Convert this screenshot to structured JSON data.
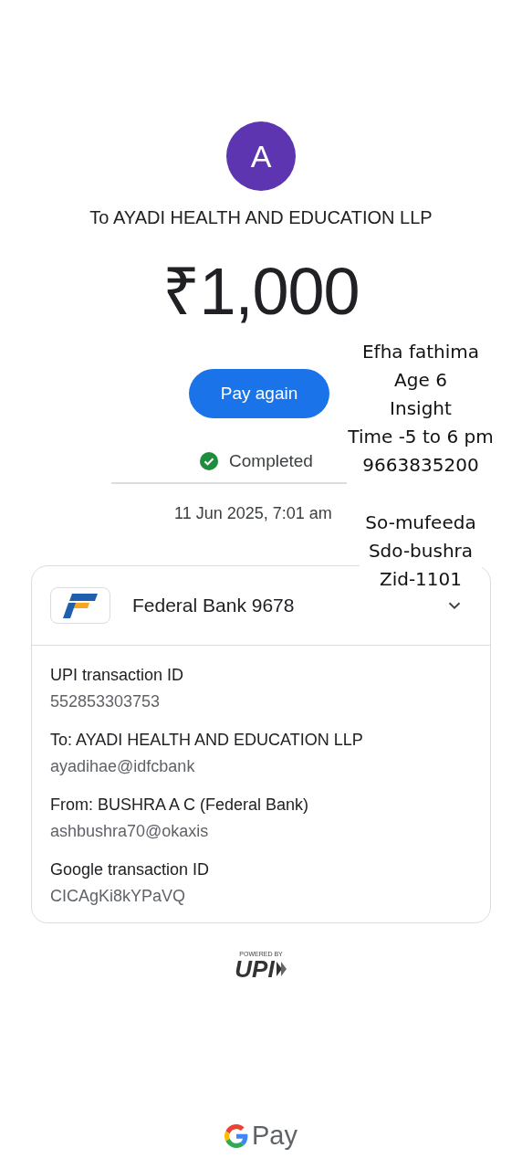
{
  "payee": {
    "avatar_letter": "A",
    "title": "To AYADI HEALTH AND EDUCATION LLP"
  },
  "amount": "₹1,000",
  "pay_again_button": "Pay again",
  "status": {
    "label": "Completed",
    "completed": true
  },
  "timestamp": "11 Jun 2025, 7:01 am",
  "account": {
    "bank": "Federal Bank 9678",
    "expanded": false
  },
  "details": [
    {
      "label": "UPI transaction ID",
      "value": "552853303753"
    },
    {
      "label": "To: AYADI HEALTH AND EDUCATION LLP",
      "value": "ayadihae@idfcbank"
    },
    {
      "label": "From: BUSHRA A C (Federal Bank)",
      "value": "ashbushra70@okaxis"
    },
    {
      "label": "Google transaction ID",
      "value": "CICAgKi8kYPaVQ"
    }
  ],
  "upi_badge": {
    "caption": "POWERED BY",
    "mark": "UPI"
  },
  "footer_brand": "Pay",
  "note": {
    "top_lines": [
      "Efha fathima",
      "Age 6",
      "Insight",
      "Time -5 to 6 pm",
      "9663835200"
    ],
    "bottom_lines": [
      "So-mufeeda",
      "Sdo-bushra",
      "Zid-1101"
    ]
  }
}
